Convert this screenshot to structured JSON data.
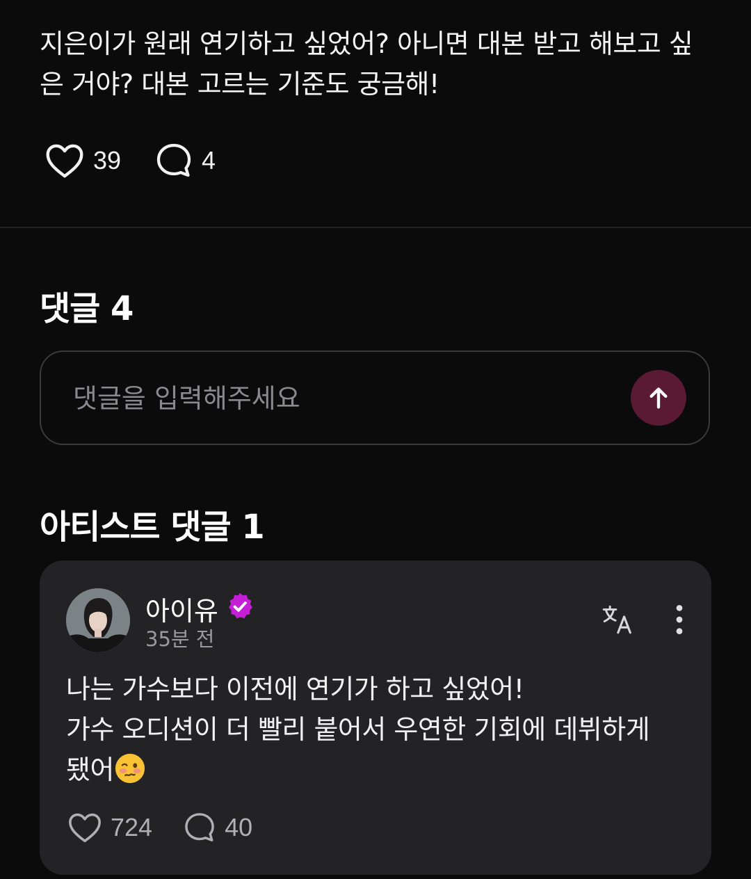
{
  "post": {
    "text": "지은이가 원래 연기하고 싶었어? 아니면 대본 받고 해보고 싶은 거야? 대본 고르는 기준도 궁금해!",
    "like_count": "39",
    "comment_count": "4"
  },
  "comments_section": {
    "title": "댓글 4",
    "input_placeholder": "댓글을 입력해주세요",
    "send_icon": "arrow-up-icon"
  },
  "artist_comments": {
    "title": "아티스트 댓글 1",
    "items": [
      {
        "author": "아이유",
        "verified": true,
        "timestamp": "35분 전",
        "text_lines": [
          "나는 가수보다 이전에 연기가 하고 싶었어!",
          "가수 오디션이 더 빨리 붙어서 우연한 기회에 데뷔하게",
          "됐어"
        ],
        "emoji": "woozy-face-emoji",
        "like_count": "724",
        "reply_count": "40"
      }
    ]
  },
  "colors": {
    "background": "#0b0b0c",
    "card": "#232325",
    "send_button": "#5a1a32",
    "verified": "#c41fd6"
  }
}
